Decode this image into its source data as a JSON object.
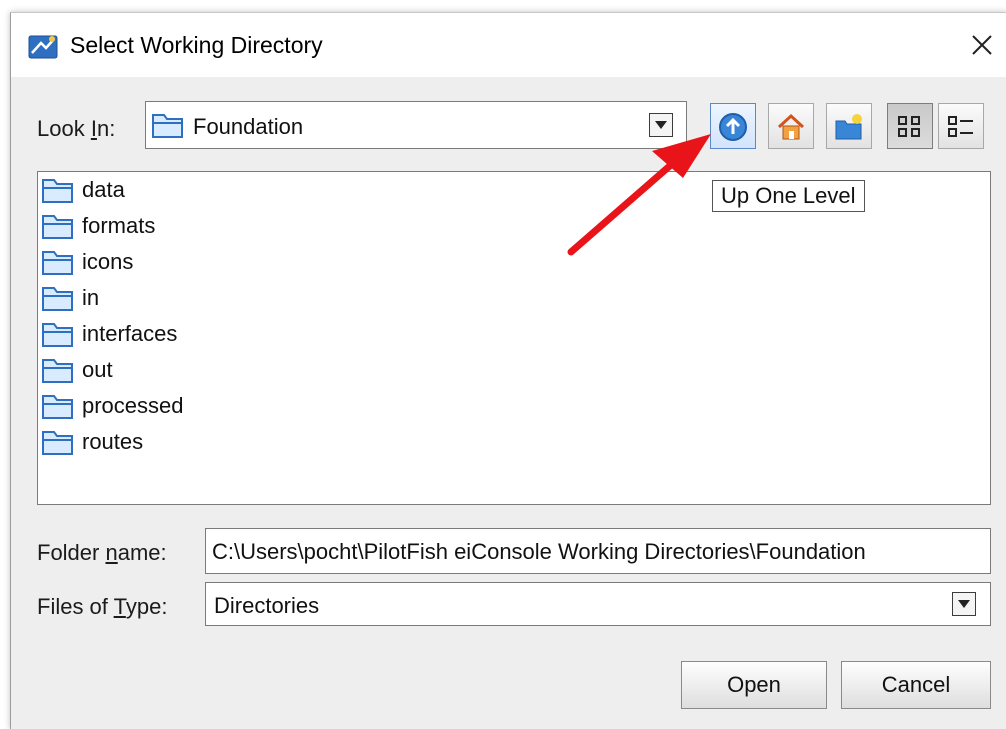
{
  "window": {
    "title": "Select Working Directory"
  },
  "look_in": {
    "label_prefix": "Look ",
    "label_underlined": "I",
    "label_suffix": "n:",
    "value": "Foundation"
  },
  "toolbar": {
    "tooltip": "Up One Level",
    "buttons": [
      "up-one-level",
      "home",
      "new-folder",
      "list-view",
      "details-view"
    ]
  },
  "files": {
    "items": [
      "data",
      "formats",
      "icons",
      "in",
      "interfaces",
      "out",
      "processed",
      "routes"
    ]
  },
  "folder_name": {
    "label_prefix": "Folder ",
    "label_underlined": "n",
    "label_suffix": "ame:",
    "value": "C:\\Users\\pocht\\PilotFish eiConsole Working Directories\\Foundation"
  },
  "files_of_type": {
    "label_prefix": "Files of ",
    "label_underlined": "T",
    "label_suffix": "ype:",
    "value": "Directories"
  },
  "buttons": {
    "open": "Open",
    "cancel": "Cancel"
  },
  "colors": {
    "annotation_arrow": "#e8141a",
    "folder_blue": "#3a86d6"
  }
}
